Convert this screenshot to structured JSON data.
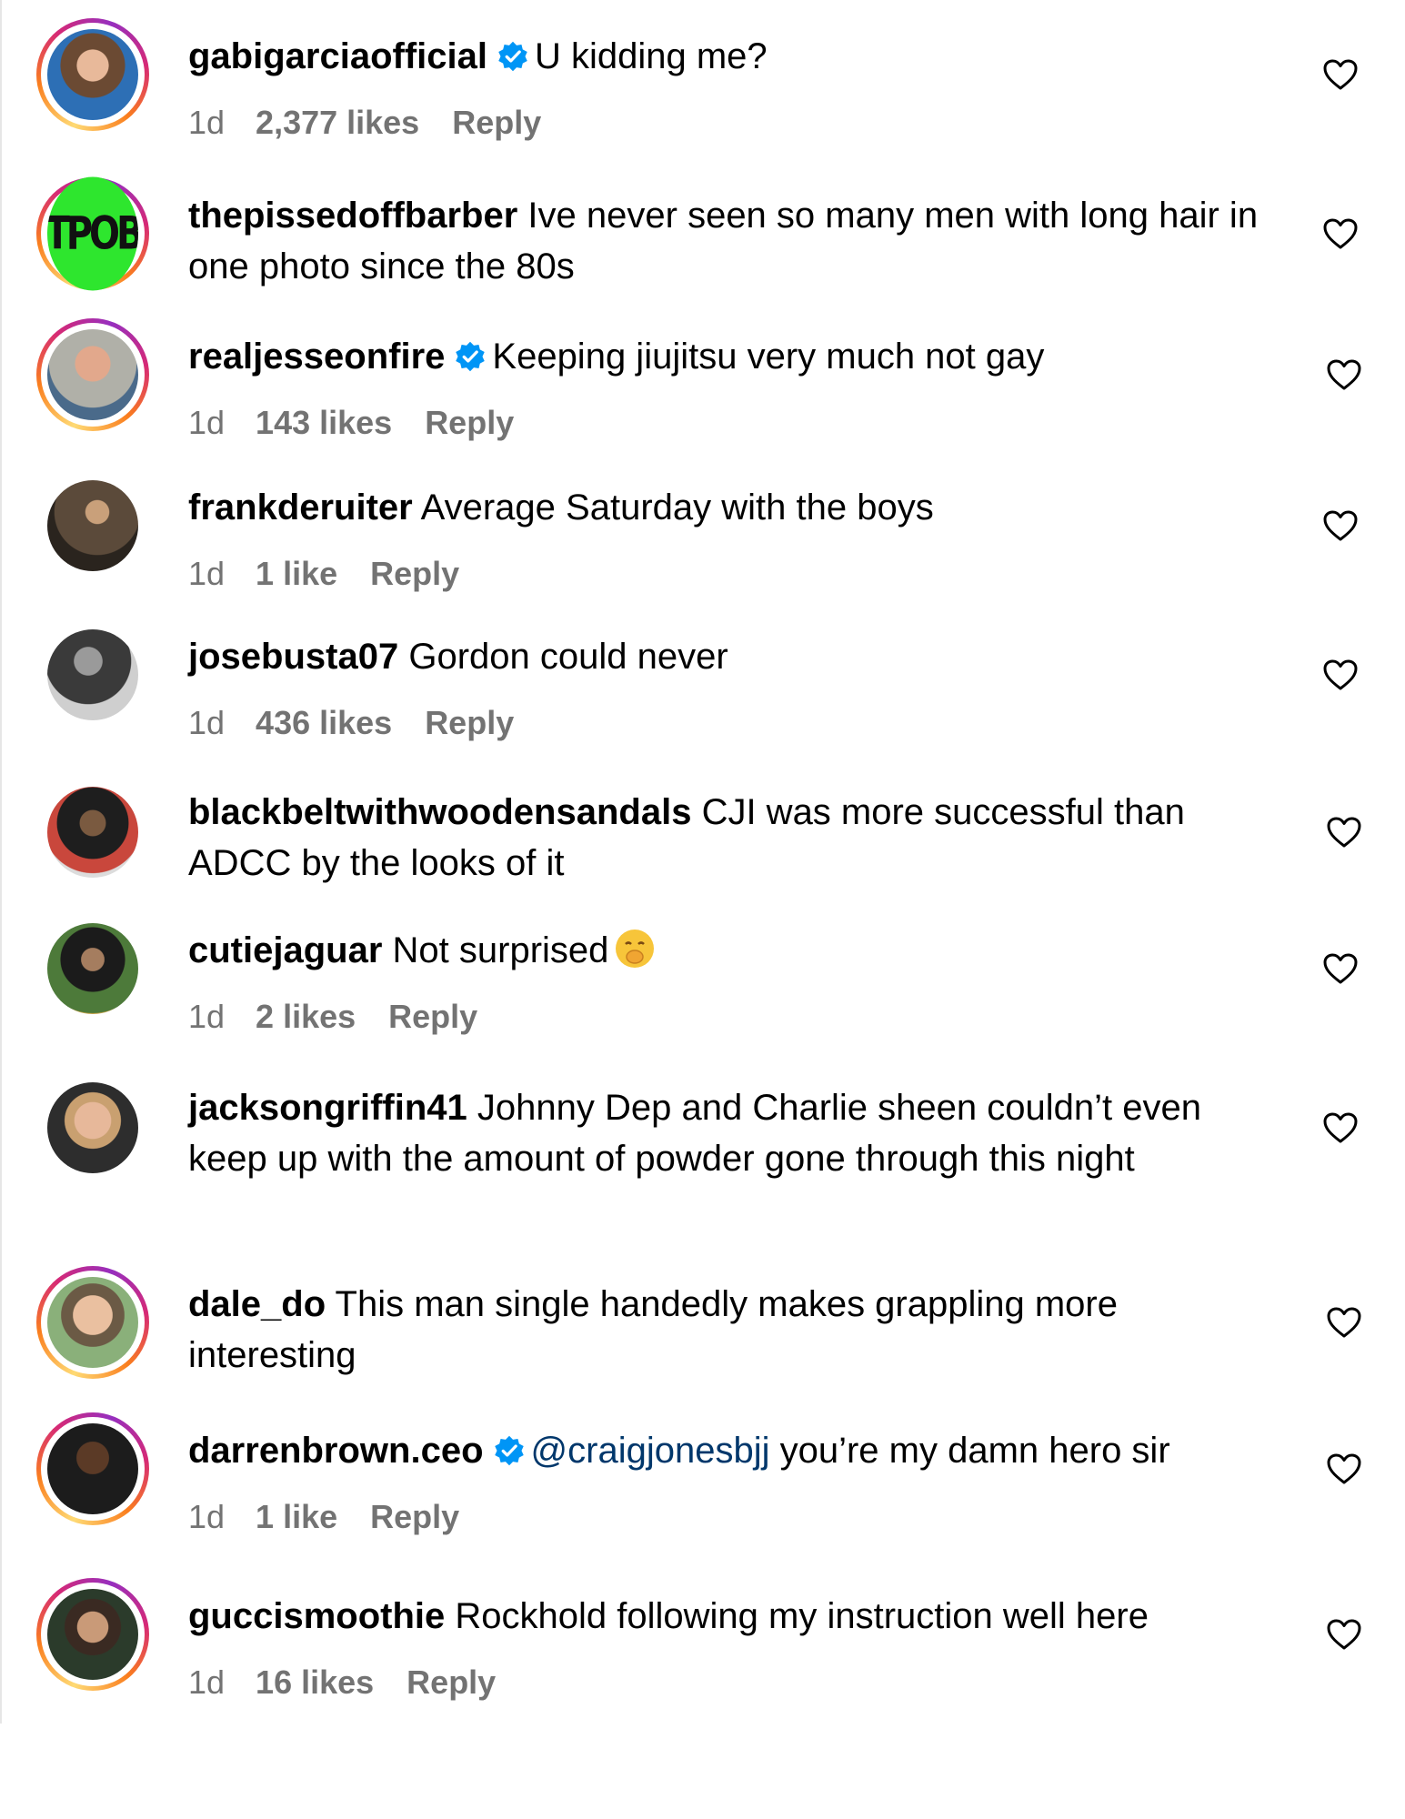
{
  "comments": [
    {
      "username": "gabigarciaofficial",
      "verified": true,
      "text": "U kidding me?",
      "time": "1d",
      "likes": "2,377 likes",
      "reply": "Reply"
    },
    {
      "username": "thepissedoffbarber",
      "verified": false,
      "text": "Ive never seen so many men with long hair in one photo since the 80s",
      "avatar_text": "TPOB"
    },
    {
      "username": "realjesseonfire",
      "verified": true,
      "text": "Keeping jiujitsu very much not gay",
      "time": "1d",
      "likes": "143 likes",
      "reply": "Reply"
    },
    {
      "username": "frankderuiter",
      "verified": false,
      "text": "Average Saturday with the boys",
      "time": "1d",
      "likes": "1 like",
      "reply": "Reply"
    },
    {
      "username": "josebusta07",
      "verified": false,
      "text": "Gordon could never",
      "time": "1d",
      "likes": "436 likes",
      "reply": "Reply"
    },
    {
      "username": "blackbeltwithwoodensandals",
      "verified": false,
      "text": "CJI was more successful than ADCC by the looks of it"
    },
    {
      "username": "cutiejaguar",
      "verified": false,
      "text": "Not surprised",
      "emoji": "face-with-hand-over-mouth-emoji",
      "time": "1d",
      "likes": "2 likes",
      "reply": "Reply"
    },
    {
      "username": "jacksongriffin41",
      "verified": false,
      "text": "Johnny Dep and Charlie sheen couldn’t even keep up with the amount of powder gone through this night"
    },
    {
      "username": "dale_do",
      "verified": false,
      "text": "This man single handedly makes grappling more interesting"
    },
    {
      "username": "darrenbrown.ceo",
      "verified": true,
      "mention": "@craigjonesbjj",
      "text": "you’re my damn hero sir",
      "time": "1d",
      "likes": "1 like",
      "reply": "Reply"
    },
    {
      "username": "guccismoothie",
      "verified": false,
      "text": "Rockhold following my instruction well here",
      "time": "1d",
      "likes": "16 likes",
      "reply": "Reply"
    }
  ],
  "colors": {
    "verified": "#0095f6",
    "meta": "#737373",
    "mention": "#00376b",
    "story_ring": "#d62976"
  },
  "icons": {
    "like": "heart-outline-icon",
    "verified": "verified-badge-icon"
  }
}
